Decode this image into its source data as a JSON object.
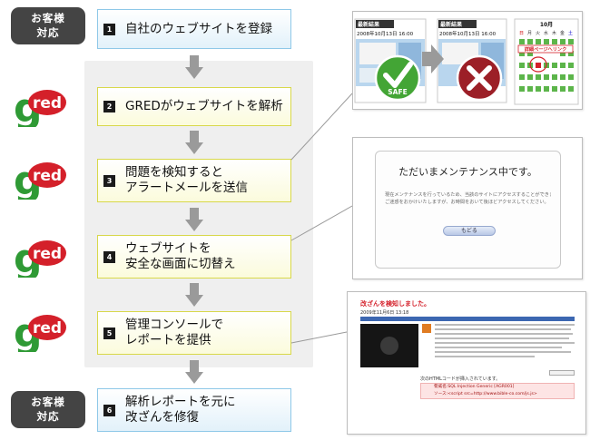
{
  "customer_badge": {
    "line1": "お客様",
    "line2": "対応"
  },
  "logo_text": "red",
  "steps": [
    {
      "num": "1",
      "lines": [
        "自社のウェブサイトを登録"
      ]
    },
    {
      "num": "2",
      "lines": [
        "GREDがウェブサイトを解析"
      ]
    },
    {
      "num": "3",
      "lines": [
        "問題を検知すると",
        "アラートメールを送信"
      ]
    },
    {
      "num": "4",
      "lines": [
        "ウェブサイトを",
        "安全な画面に切替え"
      ]
    },
    {
      "num": "5",
      "lines": [
        "管理コンソールで",
        "レポートを提供"
      ]
    },
    {
      "num": "6",
      "lines": [
        "解析レポートを元に",
        "改ざんを修復"
      ]
    }
  ],
  "shot1": {
    "page_header": "最新結果",
    "page_date": "2008年10月13日 16:00",
    "safe_label": "SAFE",
    "calendar_title": "10月",
    "calendar_weekdays": [
      "日",
      "月",
      "火",
      "水",
      "木",
      "金",
      "土"
    ],
    "calendar_callout": "詳細ページへリンク"
  },
  "shot2": {
    "title": "ただいまメンテナンス中です。",
    "body1": "現在メンテナンスを行っているため、当該のサイトにアクセスすることができません。",
    "body2": "ご迷惑をおかけいたしますが、お時間をおいて後ほどアクセスしてください。",
    "button": "もどる"
  },
  "shot3": {
    "title": "改ざんを検知しました。",
    "datetime": "2009年11月6日 13:18",
    "footer": "次のHTMLコードが挿入されています。",
    "code_line1": "脅威名:SQL Injection Generic [AGR001]",
    "code_line2": "ソース:<script src=http://www.bible-co.com/js.js>"
  },
  "colors": {
    "badge_bg": "#444444",
    "step_blue_border": "#8ec8e8",
    "step_yellow_border": "#d8d84a",
    "logo_red": "#d4202a",
    "logo_green": "#2f9a35",
    "safe_green": "#43a535",
    "danger_red": "#9c1f27"
  }
}
